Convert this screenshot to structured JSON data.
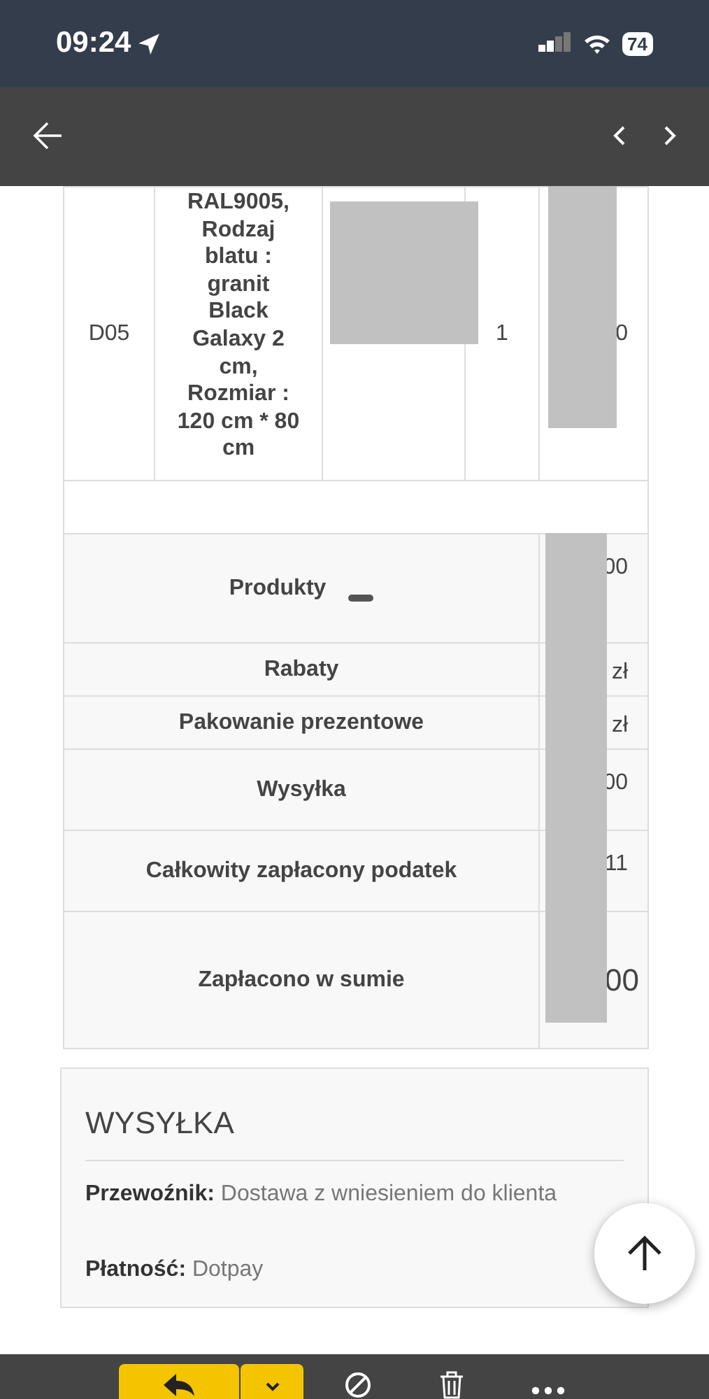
{
  "status_bar": {
    "time": "09:24",
    "battery": "74"
  },
  "product_row": {
    "reference": "D05",
    "description": "RAL9005, Rodzaj blatu : granit Black Galaxy 2 cm, Rozmiar : 120 cm * 80 cm",
    "quantity": "1",
    "price_fragment": "0"
  },
  "totals": [
    {
      "label": "Produkty",
      "value_fragment": "00",
      "kind": "tall"
    },
    {
      "label": "Rabaty",
      "value_fragment": "zł",
      "kind": "short"
    },
    {
      "label": "Pakowanie prezentowe",
      "value_fragment": "zł",
      "kind": "short"
    },
    {
      "label": "Wysyłka",
      "value_fragment": "00",
      "kind": "mid"
    },
    {
      "label": "Całkowity zapłacony podatek",
      "value_fragment": "11",
      "kind": "mid"
    },
    {
      "label": "Zapłacono w sumie",
      "value_fragment": "00",
      "kind": "grand"
    }
  ],
  "shipping": {
    "title": "WYSYŁKA",
    "fields": [
      {
        "label": "Przewoźnik:",
        "value": "Dostawa z wniesieniem do klienta"
      },
      {
        "label": "Płatność:",
        "value": "Dotpay"
      }
    ]
  }
}
